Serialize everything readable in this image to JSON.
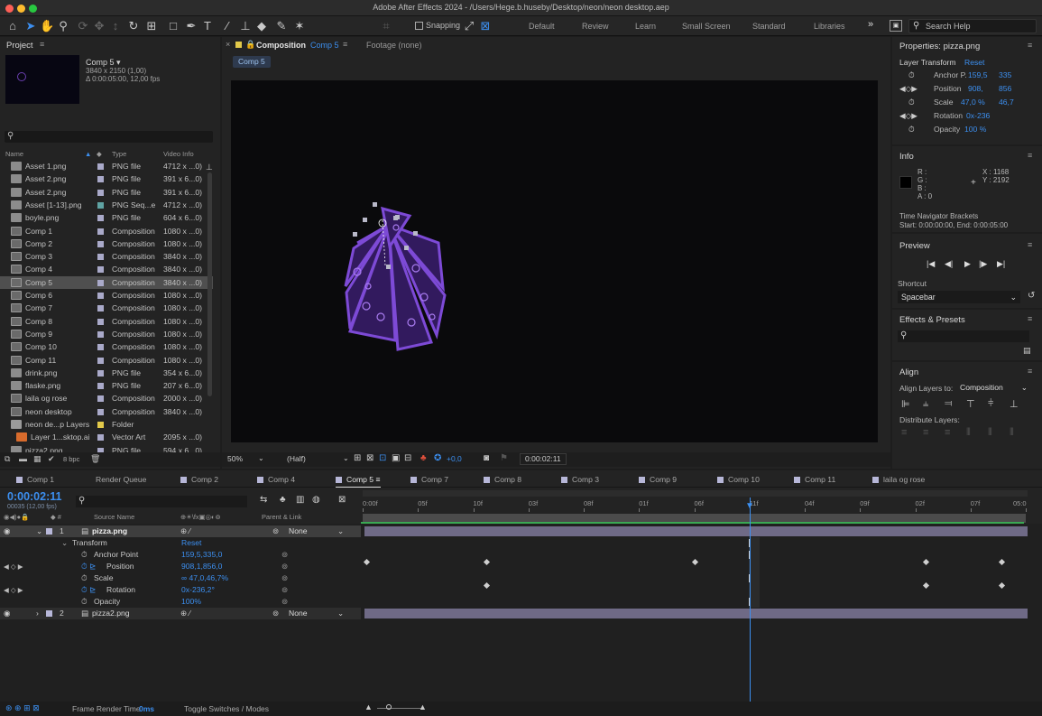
{
  "window": {
    "title": "Adobe After Effects 2024 - /Users/Hege.b.huseby/Desktop/neon/neon desktop.aep"
  },
  "toolbar": {
    "snapping_label": "Snapping",
    "workspaces": [
      "Default",
      "Review",
      "Learn",
      "Small Screen",
      "Standard",
      "Libraries"
    ],
    "more": "»",
    "search_placeholder": "Search Help"
  },
  "project": {
    "title": "Project",
    "selected_name": "Comp 5 ▾",
    "selected_size": "3840 x 2150 (1,00)",
    "selected_duration": "Δ 0:00:05:00, 12,00 fps",
    "columns": {
      "name": "Name",
      "type": "Type",
      "video": "Video Info"
    },
    "items": [
      {
        "name": "Asset 1.png",
        "type": "PNG file",
        "video": "4712 x ...0)",
        "kind": "file",
        "color": "#a9a9c9"
      },
      {
        "name": "Asset 2.png",
        "type": "PNG file",
        "video": "391 x 6...0)",
        "kind": "file",
        "color": "#a9a9c9"
      },
      {
        "name": "Asset 2.png",
        "type": "PNG file",
        "video": "391 x 6...0)",
        "kind": "file",
        "color": "#a9a9c9"
      },
      {
        "name": "Asset [1-13].png",
        "type": "PNG Seq...e",
        "video": "4712 x ...0)",
        "kind": "file",
        "color": "#5fa3a3"
      },
      {
        "name": "boyle.png",
        "type": "PNG file",
        "video": "604 x 6...0)",
        "kind": "file",
        "color": "#a9a9c9"
      },
      {
        "name": "Comp 1",
        "type": "Composition",
        "video": "1080 x ...0)",
        "kind": "comp",
        "color": "#a9a9c9"
      },
      {
        "name": "Comp 2",
        "type": "Composition",
        "video": "1080 x ...0)",
        "kind": "comp",
        "color": "#a9a9c9"
      },
      {
        "name": "Comp 3",
        "type": "Composition",
        "video": "3840 x ...0)",
        "kind": "comp",
        "color": "#a9a9c9"
      },
      {
        "name": "Comp 4",
        "type": "Composition",
        "video": "3840 x ...0)",
        "kind": "comp",
        "color": "#a9a9c9"
      },
      {
        "name": "Comp 5",
        "type": "Composition",
        "video": "3840 x ...0)",
        "kind": "comp",
        "color": "#a9a9c9",
        "selected": true
      },
      {
        "name": "Comp 6",
        "type": "Composition",
        "video": "1080 x ...0)",
        "kind": "comp",
        "color": "#a9a9c9"
      },
      {
        "name": "Comp 7",
        "type": "Composition",
        "video": "1080 x ...0)",
        "kind": "comp",
        "color": "#a9a9c9"
      },
      {
        "name": "Comp 8",
        "type": "Composition",
        "video": "1080 x ...0)",
        "kind": "comp",
        "color": "#a9a9c9"
      },
      {
        "name": "Comp 9",
        "type": "Composition",
        "video": "1080 x ...0)",
        "kind": "comp",
        "color": "#a9a9c9"
      },
      {
        "name": "Comp 10",
        "type": "Composition",
        "video": "1080 x ...0)",
        "kind": "comp",
        "color": "#a9a9c9"
      },
      {
        "name": "Comp 11",
        "type": "Composition",
        "video": "1080 x ...0)",
        "kind": "comp",
        "color": "#a9a9c9"
      },
      {
        "name": "drink.png",
        "type": "PNG file",
        "video": "354 x 6...0)",
        "kind": "file",
        "color": "#a9a9c9"
      },
      {
        "name": "flaske.png",
        "type": "PNG file",
        "video": "207 x 6...0)",
        "kind": "file",
        "color": "#a9a9c9"
      },
      {
        "name": "laila og rose",
        "type": "Composition",
        "video": "2000 x ...0)",
        "kind": "comp",
        "color": "#a9a9c9"
      },
      {
        "name": "neon desktop",
        "type": "Composition",
        "video": "3840 x ...0)",
        "kind": "comp",
        "color": "#a9a9c9"
      },
      {
        "name": "neon de...p Layers",
        "type": "Folder",
        "video": "",
        "kind": "folder",
        "color": "#e2c94a"
      },
      {
        "name": "Layer 1...sktop.ai",
        "type": "Vector Art",
        "video": "2095 x ...0)",
        "kind": "ai",
        "color": "#a9a9c9"
      },
      {
        "name": "pizza2.png",
        "type": "PNG file",
        "video": "594 x 6...0)",
        "kind": "file",
        "color": "#a9a9c9"
      }
    ],
    "bpc": "8 bpc"
  },
  "viewer": {
    "tab_label": "Composition",
    "tab_comp": "Comp 5",
    "footage_tab": "Footage (none)",
    "breadcrumb": "Comp 5",
    "zoom": "50%",
    "resolution": "(Half)",
    "exposure": "+0,0",
    "timecode": "0:00:02:11"
  },
  "properties": {
    "title": "Properties: pizza.png",
    "section": "Layer Transform",
    "reset": "Reset",
    "anchor_label": "Anchor P.",
    "anchor_x": "159,5",
    "anchor_y": "335",
    "position_label": "Position",
    "position_x": "908,",
    "position_y": "856",
    "scale_label": "Scale",
    "scale_x": "47,0 %",
    "scale_y": "46,7",
    "rotation_label": "Rotation",
    "rotation_value": "0x-236",
    "opacity_label": "Opacity",
    "opacity_value": "100 %"
  },
  "info": {
    "title": "Info",
    "r": "R :",
    "g": "G :",
    "b": "B :",
    "a": "A : 0",
    "x": "X : 1168",
    "y": "Y : 2192",
    "nav_title": "Time Navigator Brackets",
    "nav_range": "Start: 0:00:00:00, End: 0:00:05:00"
  },
  "preview": {
    "title": "Preview",
    "shortcut_label": "Shortcut",
    "shortcut_value": "Spacebar"
  },
  "effects": {
    "title": "Effects & Presets"
  },
  "align": {
    "title": "Align",
    "align_to_label": "Align Layers to:",
    "align_to_value": "Composition",
    "distribute_label": "Distribute Layers:"
  },
  "timeline": {
    "tabs": [
      {
        "label": "Comp 1",
        "color": "#b7b7d8"
      },
      {
        "label": "Render Queue",
        "color": ""
      },
      {
        "label": "Comp 2",
        "color": "#b7b7d8"
      },
      {
        "label": "Comp 4",
        "color": "#b7b7d8"
      },
      {
        "label": "Comp 5",
        "color": "#b7b7d8",
        "active": true
      },
      {
        "label": "Comp 7",
        "color": "#b7b7d8"
      },
      {
        "label": "Comp 8",
        "color": "#b7b7d8"
      },
      {
        "label": "Comp 3",
        "color": "#b7b7d8"
      },
      {
        "label": "Comp 9",
        "color": "#b7b7d8"
      },
      {
        "label": "Comp 10",
        "color": "#b7b7d8"
      },
      {
        "label": "Comp 11",
        "color": "#b7b7d8"
      },
      {
        "label": "laila og rose",
        "color": "#b7b7d8"
      }
    ],
    "timecode": "0:00:02:11",
    "frame_info": "00035 (12,00 fps)",
    "col_source": "Source Name",
    "col_parent": "Parent & Link",
    "ruler": [
      "0:00f",
      "05f",
      "10f",
      "03f",
      "08f",
      "01f",
      "06f",
      "11f",
      "04f",
      "09f",
      "02f",
      "07f",
      "05:0"
    ],
    "layers": [
      {
        "num": "1",
        "name": "pizza.png",
        "parent": "None"
      },
      {
        "num": "2",
        "name": "pizza2.png",
        "parent": "None"
      }
    ],
    "transform_label": "Transform",
    "transform_reset": "Reset",
    "props": [
      {
        "name": "Anchor Point",
        "value": "159,5,335,0"
      },
      {
        "name": "Position",
        "value": "908,1,856,0"
      },
      {
        "name": "Scale",
        "value": "∞ 47,0,46,7%"
      },
      {
        "name": "Rotation",
        "value": "0x-236,2°"
      },
      {
        "name": "Opacity",
        "value": "100%"
      }
    ],
    "frame_render_label": "Frame Render Time",
    "frame_render_value": "0ms",
    "toggle_label": "Toggle Switches / Modes"
  }
}
